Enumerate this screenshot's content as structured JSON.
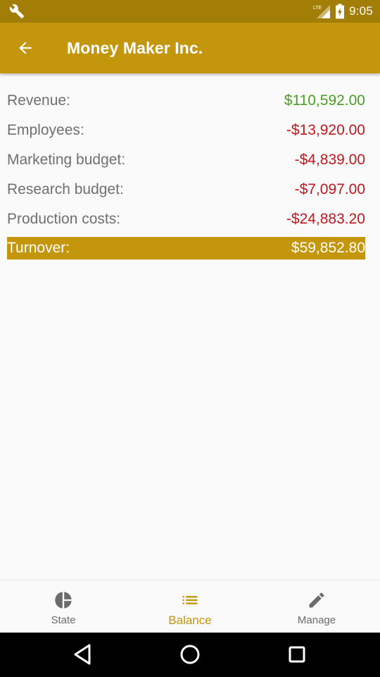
{
  "status_bar": {
    "time": "9:05",
    "network_label": "LTE",
    "icons": [
      "wrench-icon",
      "lte-signal-icon",
      "battery-icon"
    ]
  },
  "app_bar": {
    "title": "Money Maker Inc.",
    "back_icon": "arrow-back-icon"
  },
  "balance": {
    "rows": [
      {
        "label": "Revenue:",
        "value": "$110,592.00",
        "status": "positive"
      },
      {
        "label": "Employees:",
        "value": "-$13,920.00",
        "status": "negative"
      },
      {
        "label": "Marketing budget:",
        "value": "-$4,839.00",
        "status": "negative"
      },
      {
        "label": "Research budget:",
        "value": "-$7,097.00",
        "status": "negative"
      },
      {
        "label": "Production costs:",
        "value": "-$24,883.20",
        "status": "negative"
      }
    ],
    "total": {
      "label": "Turnover:",
      "value": "$59,852.80"
    }
  },
  "bottom_nav": {
    "items": [
      {
        "label": "State",
        "icon": "pie-chart-icon",
        "active": false
      },
      {
        "label": "Balance",
        "icon": "list-icon",
        "active": true
      },
      {
        "label": "Manage",
        "icon": "pencil-icon",
        "active": false
      }
    ]
  },
  "system_nav": {
    "icons": [
      "back-triangle-icon",
      "home-circle-icon",
      "recents-square-icon"
    ]
  },
  "colors": {
    "status_bar": "#a27e06",
    "primary": "#c4960c",
    "positive": "#48a021",
    "negative": "#c4161c",
    "label": "#6f6f6f",
    "nav_inactive": "#6b6b6b",
    "background": "#fafafa"
  }
}
